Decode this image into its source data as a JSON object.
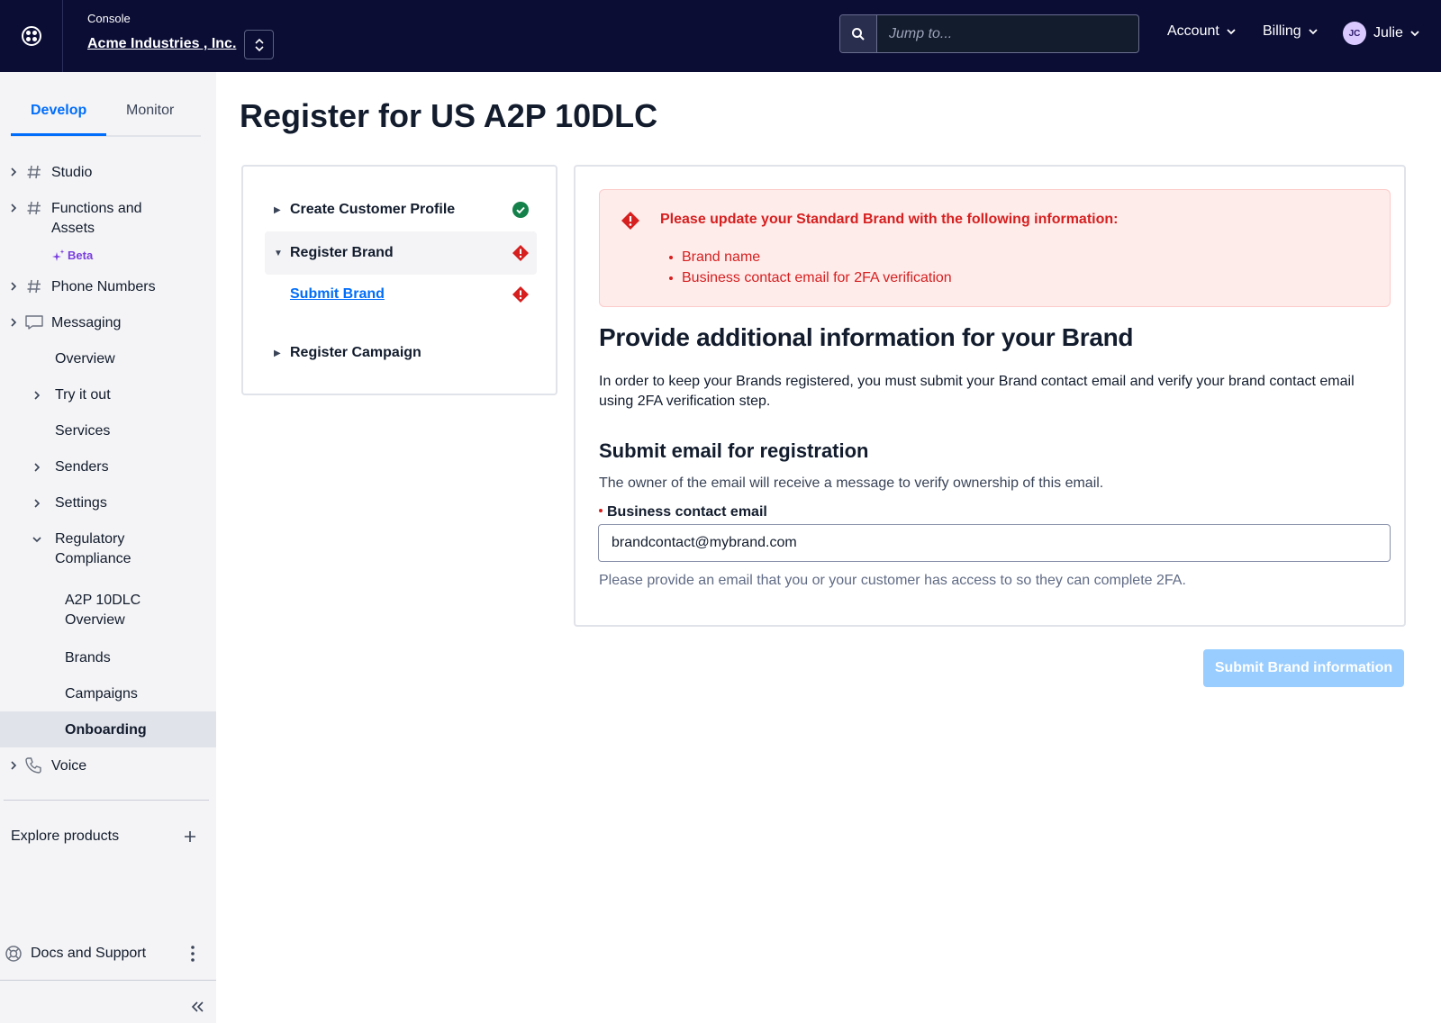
{
  "header": {
    "console_label": "Console",
    "account_name": "Acme Industries , Inc.",
    "search_placeholder": "Jump to...",
    "menu_account": "Account",
    "menu_billing": "Billing",
    "user_initials": "JC",
    "user_name": "Julie"
  },
  "sidebar": {
    "tabs": [
      {
        "label": "Develop"
      },
      {
        "label": "Monitor"
      }
    ],
    "items": [
      {
        "label": "Studio",
        "icon": "hash-icon"
      },
      {
        "label": "Functions and Assets",
        "icon": "hash-icon",
        "badge": "Beta"
      },
      {
        "label": "Phone Numbers",
        "icon": "hash-icon"
      },
      {
        "label": "Messaging",
        "icon": "chat-icon"
      },
      {
        "label": "Overview"
      },
      {
        "label": "Try it out"
      },
      {
        "label": "Services"
      },
      {
        "label": "Senders"
      },
      {
        "label": "Settings"
      },
      {
        "label": "Regulatory Compliance"
      },
      {
        "label": "A2P 10DLC Overview"
      },
      {
        "label": "Brands"
      },
      {
        "label": "Campaigns"
      },
      {
        "label": "Onboarding",
        "active": true
      },
      {
        "label": "Voice",
        "icon": "phone-icon"
      }
    ],
    "explore_label": "Explore products",
    "docs_label": "Docs and Support"
  },
  "main": {
    "page_title": "Register for US A2P 10DLC",
    "steps": [
      {
        "label": "Create Customer Profile",
        "status": "complete"
      },
      {
        "label": "Register Brand",
        "status": "error",
        "expanded": true
      },
      {
        "label": "Submit Brand",
        "status": "error",
        "link": true
      },
      {
        "label": "Register Campaign",
        "status": "none"
      }
    ],
    "alert": {
      "title": "Please update your Standard Brand with the following information:",
      "items": [
        "Brand name",
        "Business contact email for 2FA verification"
      ]
    },
    "section_title": "Provide additional information for your Brand",
    "section_desc": "In order to keep your Brands registered, you must submit your Brand contact email and verify your brand contact email using 2FA verification step.",
    "sub_title": "Submit email for registration",
    "sub_desc": "The owner of the email will receive a message to verify ownership of this email.",
    "field_label": "Business contact email",
    "field_value": "brandcontact@mybrand.com",
    "help_text": "Please provide an email that you or your customer has access to so they can complete 2FA.",
    "submit_label": "Submit Brand information"
  },
  "colors": {
    "header_bg": "#0b0d35",
    "accent": "#006dfa",
    "error": "#d61f1f",
    "success": "#14804a",
    "disabled_button": "#99cdff"
  }
}
